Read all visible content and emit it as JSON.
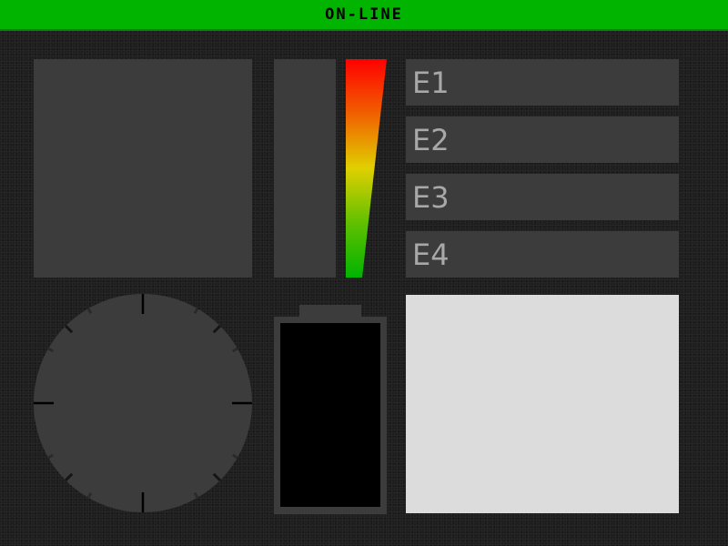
{
  "status": {
    "text": "ON-LINE",
    "color": "#00b400"
  },
  "buttons": [
    {
      "label": "E1"
    },
    {
      "label": "E2"
    },
    {
      "label": "E3"
    },
    {
      "label": "E4"
    }
  ],
  "colors": {
    "panel": "#3c3c3c",
    "background": "#1e1e1e",
    "meter_top": "#ff0000",
    "meter_mid": "#e0d000",
    "meter_bottom": "#00b400",
    "screen": "#dcdcdc",
    "battery_frame": "#3c3c3c",
    "battery_fill": "#000000"
  }
}
